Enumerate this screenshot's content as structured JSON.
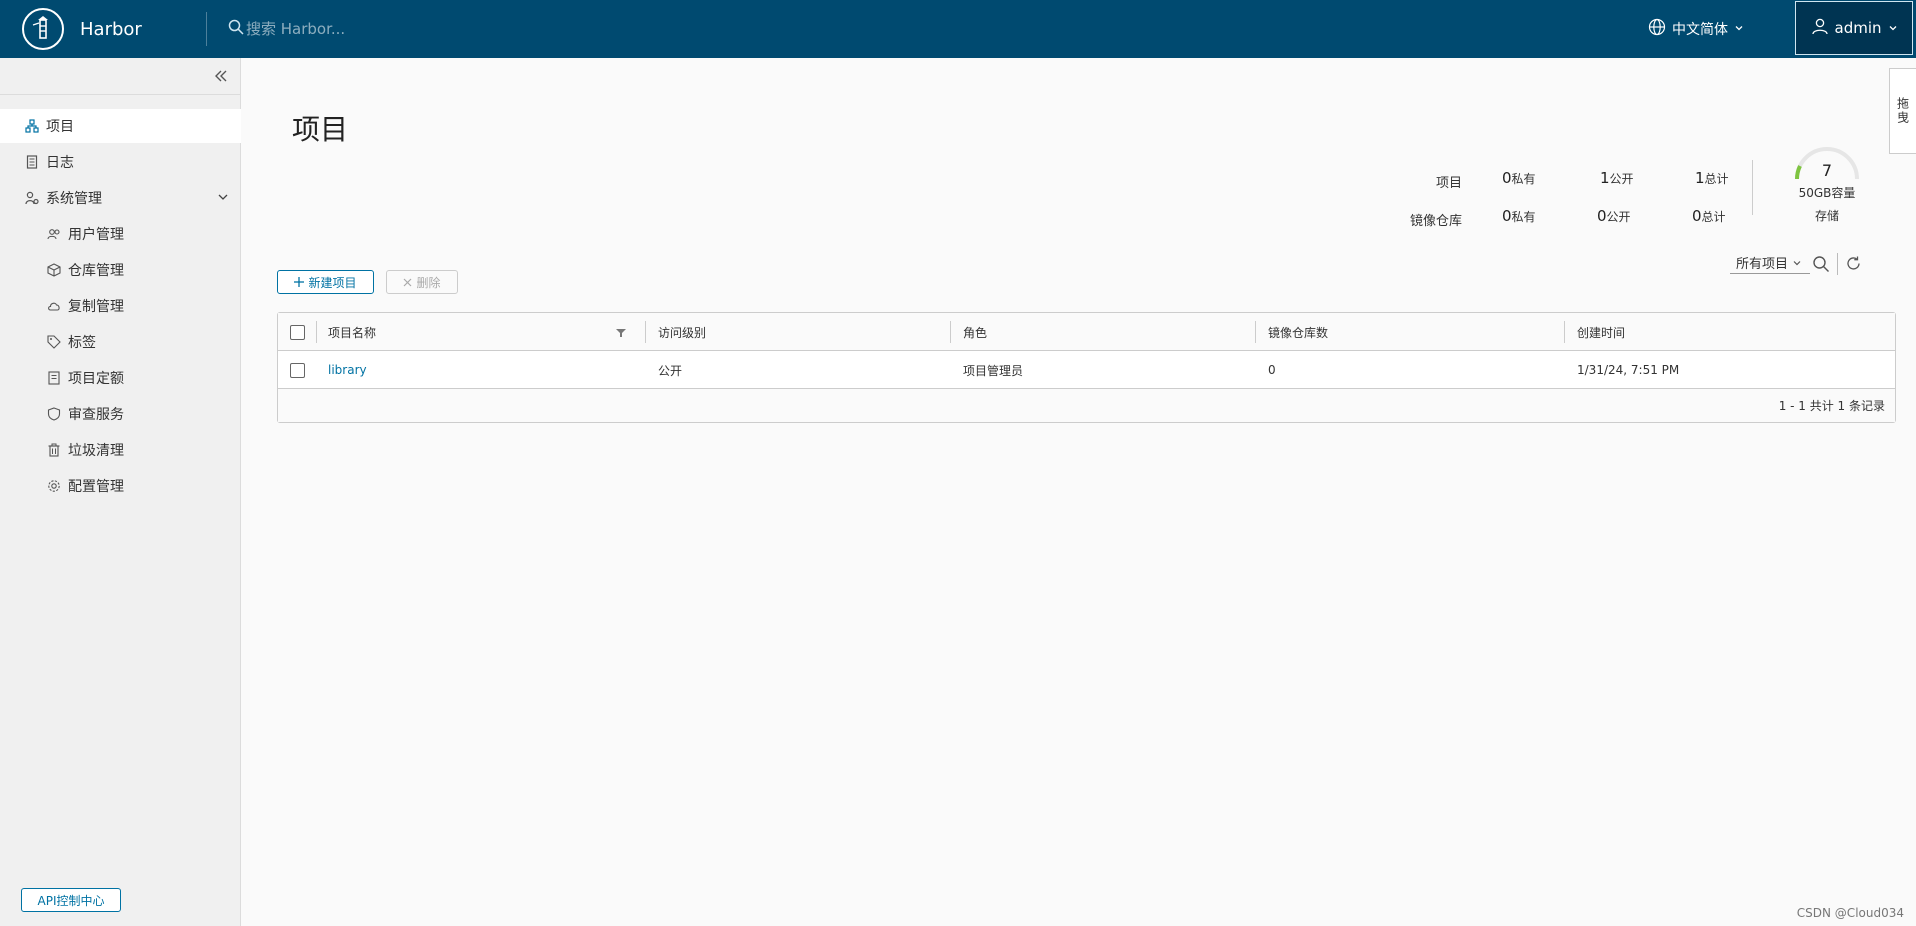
{
  "header": {
    "brand": "Harbor",
    "search_placeholder": "搜索 Harbor...",
    "language": "中文简体",
    "user": "admin",
    "bg_color": "#004a70"
  },
  "sidebar": {
    "items": [
      {
        "label": "项目",
        "icon": "projects-icon",
        "active": true
      },
      {
        "label": "日志",
        "icon": "log-icon"
      },
      {
        "label": "系统管理",
        "icon": "admin-icon",
        "expanded": true
      },
      {
        "label": "用户管理",
        "icon": "users-icon"
      },
      {
        "label": "仓库管理",
        "icon": "cube-icon"
      },
      {
        "label": "复制管理",
        "icon": "cloud-icon"
      },
      {
        "label": "标签",
        "icon": "tag-icon"
      },
      {
        "label": "项目定额",
        "icon": "quota-icon"
      },
      {
        "label": "审查服务",
        "icon": "shield-icon"
      },
      {
        "label": "垃圾清理",
        "icon": "trash-icon"
      },
      {
        "label": "配置管理",
        "icon": "gear-icon"
      }
    ],
    "api_button": "API控制中心"
  },
  "main": {
    "title": "项目",
    "stats": {
      "projects_label": "项目",
      "repos_label": "镜像仓库",
      "private_label": "私有",
      "public_label": "公开",
      "total_label": "总计",
      "projects": {
        "private": "0",
        "public": "1",
        "total": "1"
      },
      "repos": {
        "private": "0",
        "public": "0",
        "total": "0"
      }
    },
    "storage": {
      "value": "7",
      "capacity": "50GB容量",
      "label": "存储"
    },
    "buttons": {
      "new_project": "新建项目",
      "delete": "删除"
    },
    "filter": "所有项目",
    "table": {
      "headers": [
        "项目名称",
        "访问级别",
        "角色",
        "镜像仓库数",
        "创建时间"
      ],
      "rows": [
        {
          "name": "library",
          "access": "公开",
          "role": "项目管理员",
          "repo_count": "0",
          "created": "1/31/24, 7:51 PM"
        }
      ],
      "footer": "1 - 1 共计 1 条记录"
    }
  },
  "side_tab": "拖曳",
  "watermark": "CSDN @Cloud034"
}
